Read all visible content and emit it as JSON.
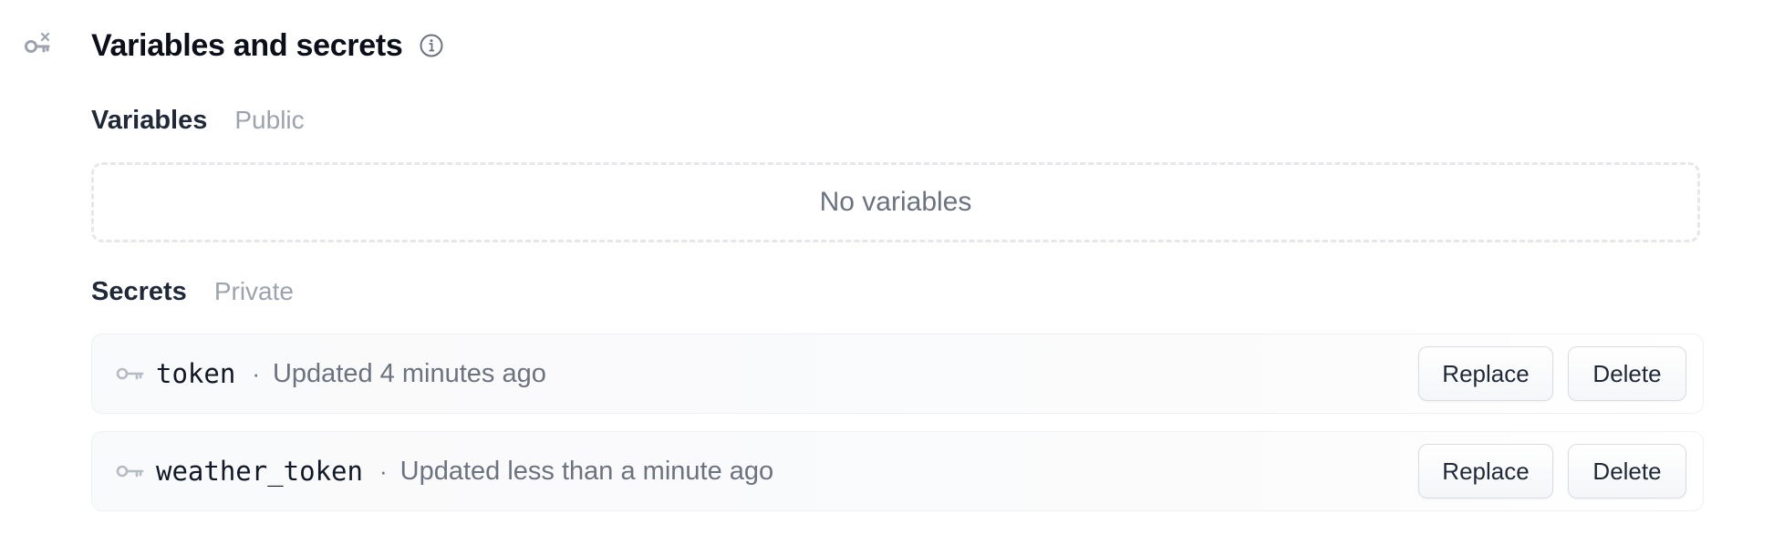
{
  "header": {
    "title": "Variables and secrets",
    "section_icon": "key-x-icon",
    "info_icon": "info-icon"
  },
  "variables": {
    "label": "Variables",
    "tag": "Public",
    "empty_text": "No variables"
  },
  "secrets": {
    "label": "Secrets",
    "tag": "Private",
    "separator": "·",
    "items": [
      {
        "name": "token",
        "updated": "Updated 4 minutes ago",
        "replace_label": "Replace",
        "delete_label": "Delete"
      },
      {
        "name": "weather_token",
        "updated": "Updated less than a minute ago",
        "replace_label": "Replace",
        "delete_label": "Delete"
      }
    ]
  },
  "colors": {
    "title": "#0b0f19",
    "muted": "#9ca3af",
    "secondary_text": "#6b7280",
    "row_bg": "#f9fafb",
    "border": "#e5e7eb"
  }
}
